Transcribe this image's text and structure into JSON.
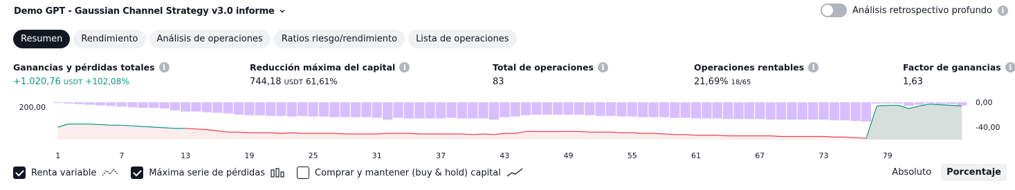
{
  "header": {
    "title": "Demo GPT - Gaussian Channel Strategy v3.0 informe",
    "deep_backtest_label": "Análisis retrospectivo profundo",
    "deep_backtest_enabled": false
  },
  "tabs": [
    {
      "label": "Resumen",
      "active": true
    },
    {
      "label": "Rendimiento",
      "active": false
    },
    {
      "label": "Análisis de operaciones",
      "active": false
    },
    {
      "label": "Ratios riesgo/rendimiento",
      "active": false
    },
    {
      "label": "Lista de operaciones",
      "active": false
    }
  ],
  "metrics": {
    "pnl": {
      "label": "Ganancias y pérdidas totales",
      "value": "+1.020,76",
      "unit": "USDT",
      "extra": "+102,08%"
    },
    "drawdown": {
      "label": "Reducción máxima del capital",
      "value": "744,18",
      "unit": "USDT",
      "extra": "61,61%"
    },
    "total_trades": {
      "label": "Total de operaciones",
      "value": "83"
    },
    "profitable": {
      "label": "Operaciones rentables",
      "value": "21,69%",
      "extra": "18/65"
    },
    "profit_factor": {
      "label": "Factor de ganancias",
      "value": "1,63"
    }
  },
  "legend": {
    "equity": {
      "label": "Renta variable",
      "checked": true,
      "icon": "equity-line-icon"
    },
    "drawdown": {
      "label": "Máxima serie de pérdidas",
      "checked": true,
      "icon": "drawdown-bars-icon"
    },
    "buyhold": {
      "label": "Comprar y mantener (buy & hold) capital",
      "checked": false,
      "icon": "buyhold-line-icon"
    }
  },
  "modes": [
    {
      "label": "Absoluto",
      "active": false
    },
    {
      "label": "Porcentaje",
      "active": true
    }
  ],
  "colors": {
    "equity_pos": "#089981",
    "equity_neg": "#f23645",
    "drawdown": "#d1b3ff",
    "accent": "#131722"
  },
  "chart_data": {
    "type": "bar",
    "x_ticks": [
      "1",
      "7",
      "13",
      "19",
      "25",
      "31",
      "37",
      "43",
      "49",
      "55",
      "61",
      "67",
      "73",
      "79"
    ],
    "left_axis_labels": [
      "200,00"
    ],
    "right_axis_labels": [
      "0,00",
      "-40,00"
    ],
    "right_ylim": [
      -60,
      0
    ],
    "equity": [
      -40,
      -35,
      -35,
      -35,
      -36,
      -37,
      -37,
      -38,
      -39,
      -40,
      -41,
      -42,
      -42,
      -43,
      -44,
      -46,
      -48,
      -48,
      -49,
      -49,
      -49,
      -50,
      -49,
      -50,
      -50,
      -50,
      -50,
      -51,
      -51,
      -51,
      -51,
      -50,
      -50,
      -50,
      -51,
      -51,
      -51,
      -51,
      -51,
      -52,
      -51,
      -52,
      -50,
      -50,
      -47,
      -47,
      -47,
      -47,
      -47,
      -47,
      -48,
      -48,
      -48,
      -49,
      -49,
      -50,
      -50,
      -51,
      -52,
      -52,
      -53,
      -53,
      -53,
      -54,
      -54,
      -54,
      -54,
      -54,
      -55,
      -55,
      -55,
      -55,
      -55,
      -56,
      -56,
      -57,
      -58,
      -6,
      -5,
      -5,
      -10,
      -6,
      -3,
      -4,
      -5,
      -6
    ],
    "drawdown": [
      -1,
      -2,
      -3,
      -4,
      -5,
      -6,
      -7,
      -8,
      -9,
      -9,
      -10,
      -13,
      -15,
      -15,
      -16,
      -17,
      -18,
      -20,
      -21,
      -21,
      -22,
      -22,
      -23,
      -22,
      -23,
      -23,
      -24,
      -24,
      -24,
      -24,
      -25,
      -28,
      -25,
      -26,
      -26,
      -26,
      -26,
      -25,
      -26,
      -26,
      -26,
      -28,
      -24,
      -23,
      -21,
      -20,
      -20,
      -20,
      -20,
      -20,
      -21,
      -22,
      -22,
      -23,
      -23,
      -24,
      -24,
      -24,
      -25,
      -25,
      -26,
      -26,
      -26,
      -27,
      -27,
      -27,
      -27,
      -28,
      -28,
      -28,
      -28,
      -28,
      -28,
      -29,
      -29,
      -30,
      -31,
      -2,
      -2,
      -2,
      -6,
      -4,
      -2,
      -3,
      -3,
      -5
    ]
  }
}
